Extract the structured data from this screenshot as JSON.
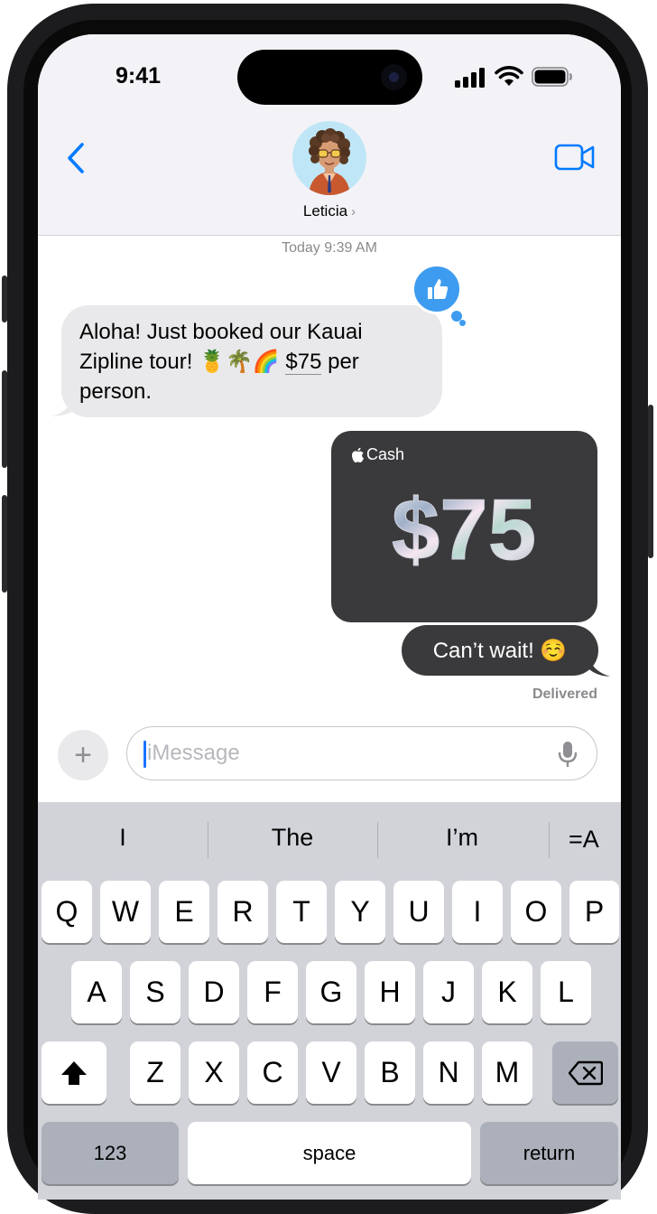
{
  "status_bar": {
    "time": "9:41"
  },
  "header": {
    "contact_name": "Leticia",
    "chevron": "›"
  },
  "conversation": {
    "timestamp": "Today 9:39 AM",
    "incoming": {
      "line1": "Aloha! Just booked our Kauai",
      "line2_prefix": "Zipline tour! 🍍🌴🌈 ",
      "amount_link": "$75",
      "line2_suffix": " per",
      "line3": "person.",
      "reaction_icon": "thumbs-up-icon"
    },
    "cash_card": {
      "apple_glyph": "",
      "label": "Cash",
      "amount": "$75"
    },
    "outgoing": {
      "text": "Can’t wait! ☺️"
    },
    "delivery_status": "Delivered"
  },
  "composer": {
    "placeholder": "iMessage",
    "plus_label": "+"
  },
  "keyboard": {
    "suggestions": [
      "I",
      "The",
      "I’m"
    ],
    "format_label": "=A",
    "row1": [
      "Q",
      "W",
      "E",
      "R",
      "T",
      "Y",
      "U",
      "I",
      "O",
      "P"
    ],
    "row2": [
      "A",
      "S",
      "D",
      "F",
      "G",
      "H",
      "J",
      "K",
      "L"
    ],
    "row3": [
      "Z",
      "X",
      "C",
      "V",
      "B",
      "N",
      "M"
    ],
    "numbers_label": "123",
    "space_label": "space",
    "return_label": "return"
  },
  "colors": {
    "accent": "#007aff",
    "incoming_bubble": "#e9e9eb",
    "outgoing_bubble": "#3a3a3c",
    "tapback": "#3d9cf0"
  }
}
